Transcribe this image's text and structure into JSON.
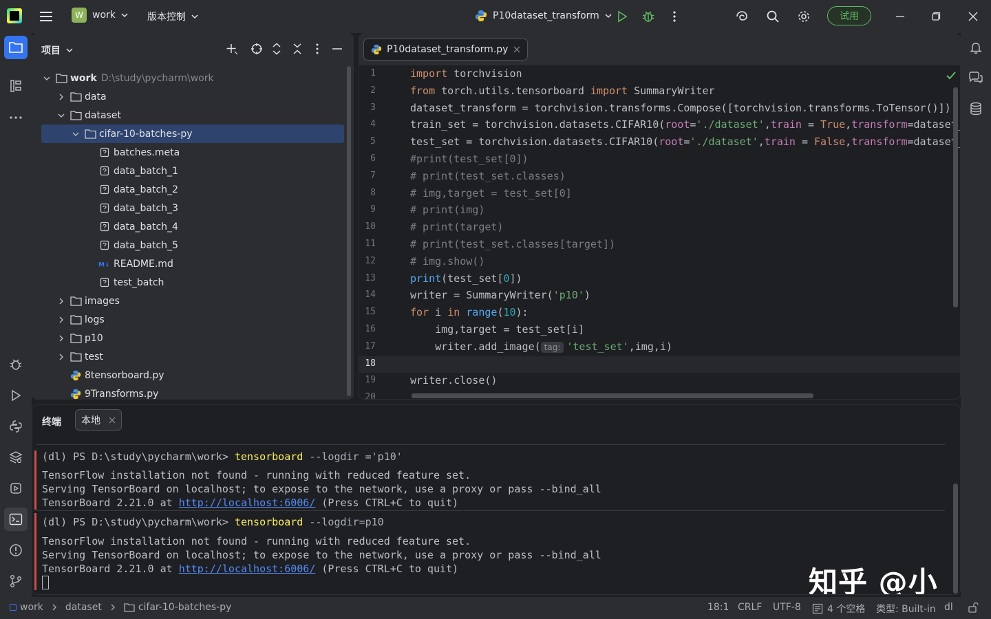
{
  "titlebar": {
    "project_badge": "W",
    "project_name": "work",
    "vcs_label": "版本控制",
    "run_config": "P10dataset_transform",
    "trial_label": "试用"
  },
  "project_panel": {
    "title": "项目",
    "tree": [
      {
        "label": "work",
        "path": "D:\\study\\pycharm\\work",
        "type": "root",
        "depth": 0,
        "expanded": true
      },
      {
        "label": "data",
        "type": "folder",
        "depth": 1,
        "expanded": false
      },
      {
        "label": "dataset",
        "type": "folder",
        "depth": 1,
        "expanded": true
      },
      {
        "label": "cifar-10-batches-py",
        "type": "folder",
        "depth": 2,
        "expanded": true,
        "selected": true
      },
      {
        "label": "batches.meta",
        "type": "file",
        "depth": 3
      },
      {
        "label": "data_batch_1",
        "type": "file",
        "depth": 3
      },
      {
        "label": "data_batch_2",
        "type": "file",
        "depth": 3
      },
      {
        "label": "data_batch_3",
        "type": "file",
        "depth": 3
      },
      {
        "label": "data_batch_4",
        "type": "file",
        "depth": 3
      },
      {
        "label": "data_batch_5",
        "type": "file",
        "depth": 3
      },
      {
        "label": "README.md",
        "type": "md",
        "depth": 3
      },
      {
        "label": "test_batch",
        "type": "file",
        "depth": 3
      },
      {
        "label": "images",
        "type": "folder",
        "depth": 1,
        "expanded": false
      },
      {
        "label": "logs",
        "type": "folder",
        "depth": 1,
        "expanded": false
      },
      {
        "label": "p10",
        "type": "folder",
        "depth": 1,
        "expanded": false
      },
      {
        "label": "test",
        "type": "folder",
        "depth": 1,
        "expanded": false
      },
      {
        "label": "8tensorboard.py",
        "type": "py",
        "depth": 1
      },
      {
        "label": "9Transforms.py",
        "type": "py",
        "depth": 1
      }
    ]
  },
  "editor": {
    "tab_label": "P10dataset_transform.py",
    "current_line": "18",
    "line_numbers": [
      "1",
      "2",
      "3",
      "4",
      "5",
      "6",
      "7",
      "8",
      "9",
      "10",
      "11",
      "12",
      "13",
      "14",
      "15",
      "16",
      "17",
      "18",
      "19",
      "20"
    ],
    "code": {
      "l1_kw": "import",
      "l1_rest": " torchvision",
      "l2_kw1": "from",
      "l2_mid": " torch.utils.tensorboard ",
      "l2_kw2": "import",
      "l2_rest": " SummaryWriter",
      "l3": "dataset_transform = torchvision.transforms.Compose([torchvision.transforms.ToTensor()])",
      "l4_a": "train_set = torchvision.datasets.CIFAR10(",
      "l4_p1": "root",
      "l4_eq1": "=",
      "l4_s1": "'./dataset'",
      "l4_c1": ",",
      "l4_p2": "train",
      "l4_eq2": " = ",
      "l4_kw": "True",
      "l4_c2": ",",
      "l4_p3": "transform",
      "l4_end": "=dataset_",
      "l5_a": "test_set = torchvision.datasets.CIFAR10(",
      "l5_p1": "root",
      "l5_eq1": "=",
      "l5_s1": "'./dataset'",
      "l5_c1": ",",
      "l5_p2": "train",
      "l5_eq2": " = ",
      "l5_kw": "False",
      "l5_c2": ",",
      "l5_p3": "transform",
      "l5_end": "=dataset_",
      "l6": "#print(test_set[0])",
      "l7": "# print(test_set.classes)",
      "l8": "# img,target = test_set[0]",
      "l9": "# print(img)",
      "l10": "# print(target)",
      "l11": "# print(test_set.classes[target])",
      "l12": "# img.show()",
      "l13_fn": "print",
      "l13_a": "(test_set[",
      "l13_num": "0",
      "l13_b": "])",
      "l14_a": "writer = SummaryWriter(",
      "l14_s": "'p10'",
      "l14_b": ")",
      "l15_kw1": "for",
      "l15_a": " i ",
      "l15_kw2": "in",
      "l15_sp": " ",
      "l15_fn": "range",
      "l15_b": "(",
      "l15_num": "10",
      "l15_c": "):",
      "l16": "    img,target = test_set[i]",
      "l17_a": "    writer.add_image(",
      "l17_hint": "tag:",
      "l17_s": "'test_set'",
      "l17_b": ",img,i)",
      "l18": "",
      "l19": "writer.close()",
      "l20": ""
    }
  },
  "terminal": {
    "title": "终端",
    "tab_label": "本地",
    "block1": {
      "prompt": "(dl) PS D:\\study\\pycharm\\work> ",
      "cmd": "tensorboard",
      "args": " --logdir ='p10'",
      "out1": "TensorFlow installation not found - running with reduced feature set.",
      "out2": "Serving TensorBoard on localhost; to expose to the network, use a proxy or pass --bind_all",
      "out3_a": "TensorBoard 2.21.0 at ",
      "out3_link": "http://localhost:6006/",
      "out3_b": " (Press CTRL+C to quit)"
    },
    "block2": {
      "prompt": "(dl) PS D:\\study\\pycharm\\work> ",
      "cmd": "tensorboard",
      "args": " --logdir=p10",
      "out1": "TensorFlow installation not found - running with reduced feature set.",
      "out2": "Serving TensorBoard on localhost; to expose to the network, use a proxy or pass --bind_all",
      "out3_a": "TensorBoard 2.21.0 at ",
      "out3_link": "http://localhost:6006/",
      "out3_b": " (Press CTRL+C to quit)"
    },
    "watermark": "知乎 @小申"
  },
  "statusbar": {
    "crumb1": "work",
    "crumb2": "dataset",
    "crumb3": "cifar-10-batches-py",
    "position": "18:1",
    "line_sep": "CRLF",
    "encoding": "UTF-8",
    "indent": "4 个空格",
    "interpreter": "类型: Built-in",
    "env": "dl"
  },
  "colors": {
    "accent": "#3574f0",
    "selection": "#2e436e",
    "trial_green": "#5fb865",
    "keyword": "#cf8e6d",
    "string": "#6aab73"
  }
}
